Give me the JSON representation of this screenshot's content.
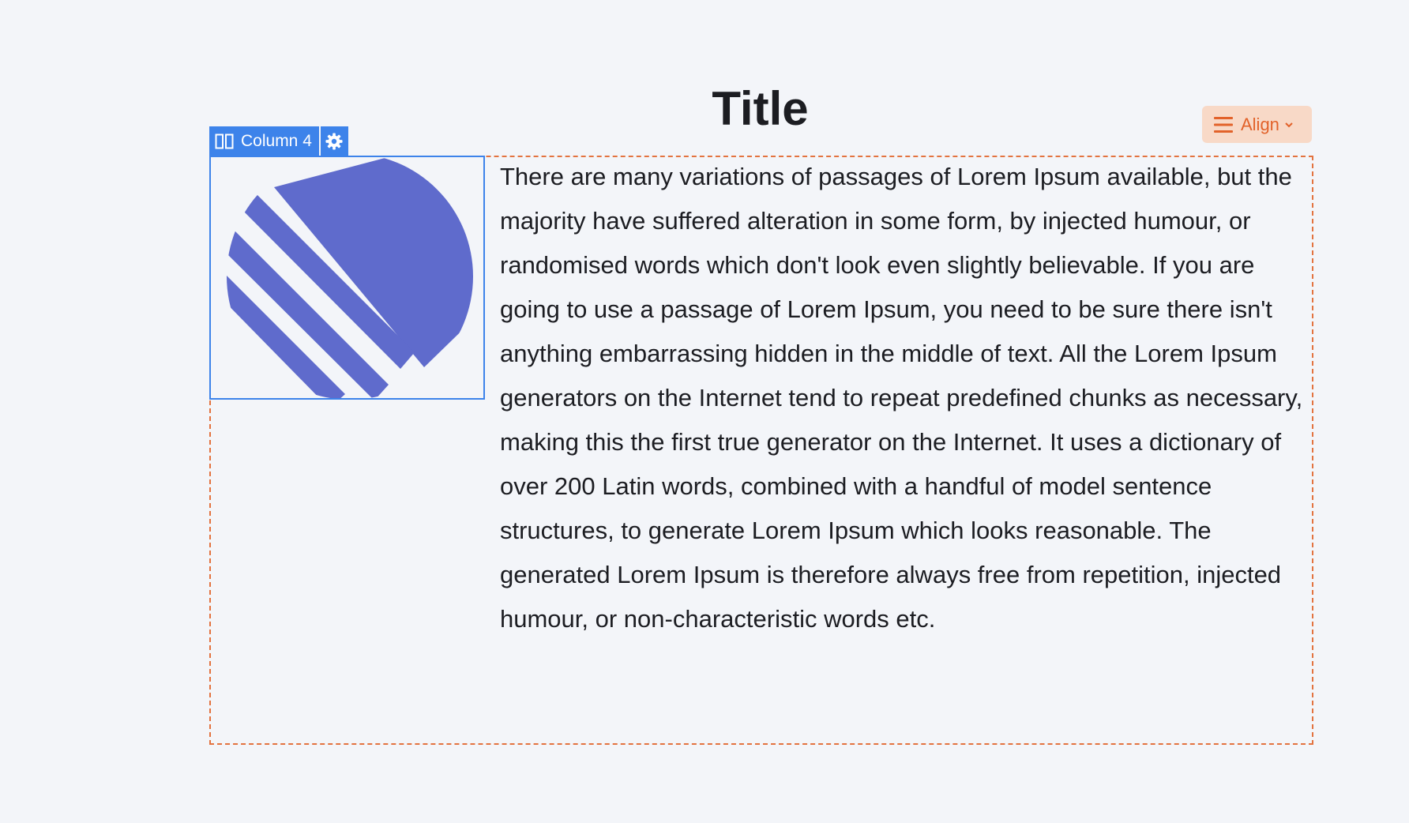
{
  "page": {
    "title": "Title"
  },
  "toolbar": {
    "align_label": "Align",
    "accent_color": "#e2622a",
    "accent_background": "#f8d9c7"
  },
  "column_block": {
    "label": "Column 4",
    "selection_color": "#3d83ea",
    "image_icon": "striped-circle-logo",
    "logo_color": "#5f6bcc"
  },
  "content": {
    "paragraph": "There are many variations of passages of Lorem Ipsum available, but the majority have suffered alteration in some form, by injected humour, or randomised words which don't look even slightly believable. If you are going to use a passage of Lorem Ipsum, you need to be sure there isn't anything embarrassing hidden in the middle of text. All the Lorem Ipsum generators on the Internet tend to repeat predefined chunks as necessary, making this the first true generator on the Internet. It uses a dictionary of over 200 Latin words, combined with a handful of model sentence structures, to generate Lorem Ipsum which looks reasonable. The generated Lorem Ipsum is therefore always free from repetition, injected humour, or non-characteristic words etc."
  }
}
